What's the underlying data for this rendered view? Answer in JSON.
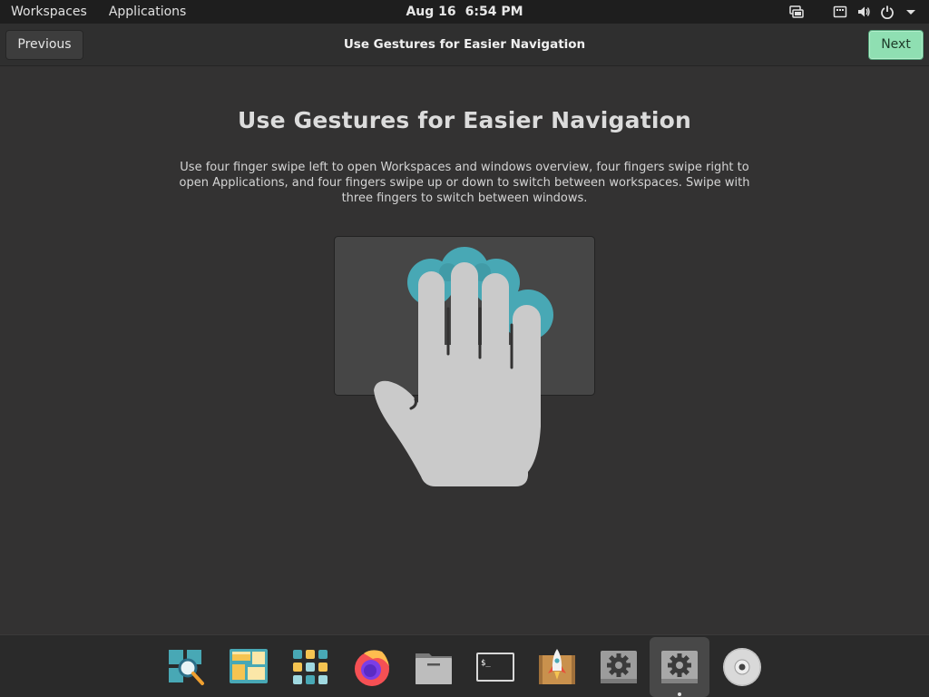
{
  "top_panel": {
    "workspaces_label": "Workspaces",
    "applications_label": "Applications",
    "date": "Aug 16",
    "time": "6:54 PM",
    "status_icons": [
      "network-icon",
      "keyboard-icon",
      "volume-icon",
      "power-icon",
      "chevron-down-icon"
    ]
  },
  "header": {
    "previous_label": "Previous",
    "title": "Use Gestures for Easier Navigation",
    "next_label": "Next"
  },
  "content": {
    "heading": "Use Gestures for Easier Navigation",
    "description": "Use four finger swipe left to open Workspaces and windows overview, four fingers swipe right to open Applications, and four fingers swipe up or down to switch between workspaces. Swipe with three fingers to switch between windows."
  },
  "dock": {
    "items": [
      {
        "name": "search-app-icon",
        "active": false
      },
      {
        "name": "workspaces-app-icon",
        "active": false
      },
      {
        "name": "applications-grid-icon",
        "active": false
      },
      {
        "name": "firefox-icon",
        "active": false
      },
      {
        "name": "files-icon",
        "active": false
      },
      {
        "name": "terminal-icon",
        "active": false
      },
      {
        "name": "pop-shop-icon",
        "active": false
      },
      {
        "name": "settings-icon",
        "active": false
      },
      {
        "name": "initial-setup-icon",
        "active": true
      },
      {
        "name": "disc-icon",
        "active": false
      }
    ]
  },
  "colors": {
    "accent_teal": "#48a8b5",
    "next_button": "#8fdfb2",
    "background": "#333232"
  }
}
